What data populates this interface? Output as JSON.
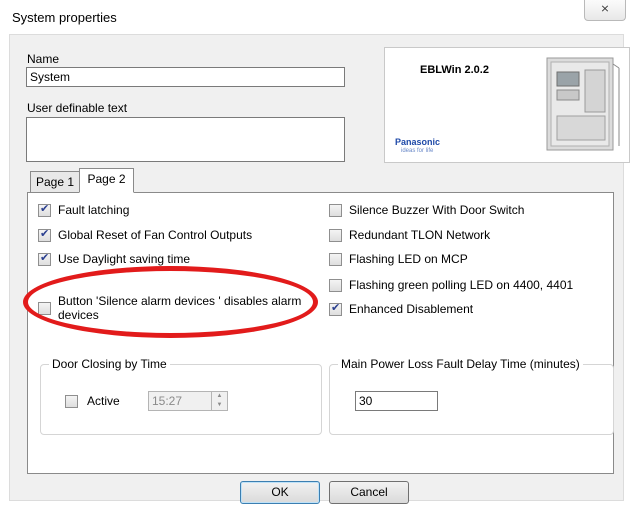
{
  "window": {
    "title": "System properties",
    "close_icon": "close-x"
  },
  "fields": {
    "name_label": "Name",
    "name_value": "System",
    "user_text_label": "User definable text",
    "user_text_value": ""
  },
  "logo": {
    "version": "EBLWin 2.0.2",
    "brand": "Panasonic",
    "tagline": "ideas for life"
  },
  "tabs": [
    {
      "label": "Page 1",
      "active": false
    },
    {
      "label": "Page 2",
      "active": true
    }
  ],
  "left_checks": [
    {
      "label": "Fault latching",
      "checked": true
    },
    {
      "label": "Global Reset of Fan Control Outputs",
      "checked": true
    },
    {
      "label": "Use Daylight saving time",
      "checked": true
    },
    {
      "label_line1": "Button 'Silence alarm devices ' disables alarm",
      "label_line2": "devices",
      "checked": false
    }
  ],
  "right_checks": [
    {
      "label": "Silence Buzzer With Door Switch",
      "checked": false
    },
    {
      "label": "Redundant TLON Network",
      "checked": false
    },
    {
      "label": "Flashing LED on MCP",
      "checked": false
    },
    {
      "label": "Flashing green polling LED on 4400, 4401",
      "checked": false
    },
    {
      "label": "Enhanced Disablement",
      "checked": true
    }
  ],
  "door_closing": {
    "legend": "Door Closing by Time",
    "active_label": "Active",
    "active_checked": false,
    "time_value": "15:27"
  },
  "power_loss": {
    "legend": "Main Power Loss Fault Delay Time (minutes)",
    "value": "30"
  },
  "buttons": {
    "ok": "OK",
    "cancel": "Cancel"
  },
  "annotation_color": "#e21b1b"
}
